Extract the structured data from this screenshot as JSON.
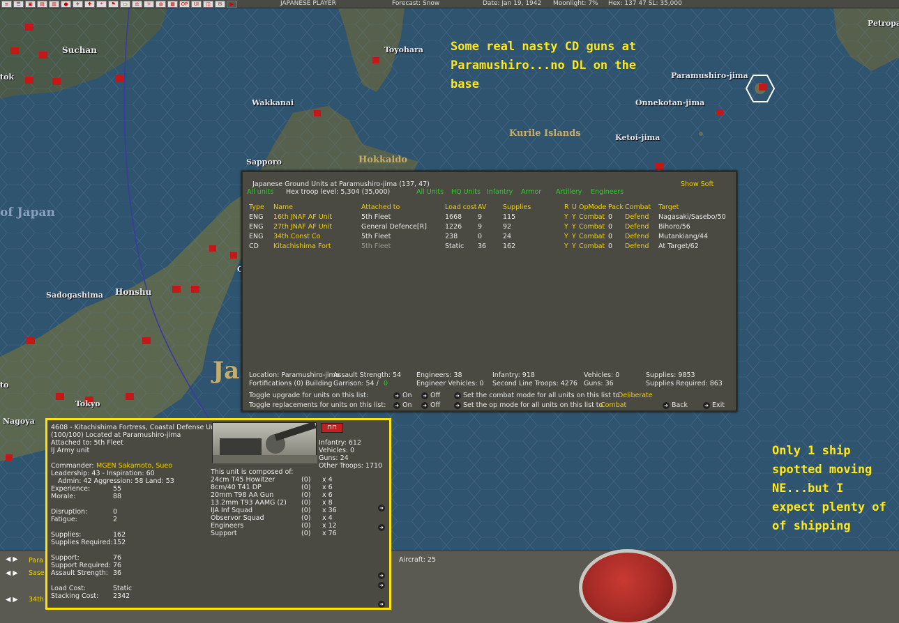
{
  "topbar": {
    "icons": [
      "menu-icon",
      "list-icon",
      "save-icon",
      "report-icon",
      "intel-icon",
      "japan-flag-icon",
      "aircraft-icon",
      "ship-icon",
      "location-icon",
      "flag-icon",
      "bars-icon",
      "balance-icon",
      "sun-icon",
      "globe-icon",
      "doc-icon",
      "op-icon",
      "ui-icon",
      "window-icon",
      "mail-icon",
      "play-icon"
    ],
    "player": "JAPANESE PLAYER",
    "forecast": "Forecast: Snow",
    "date": "Date: Jan 19, 1942",
    "moonlight": "Moonlight: 7%",
    "hex": "Hex: 137 47  SL: 35,000"
  },
  "map": {
    "places": [
      {
        "name": "Suchan"
      },
      {
        "name": "Toyohara"
      },
      {
        "name": "Wakkanai"
      },
      {
        "name": "Sapporo"
      },
      {
        "name": "Paramushiro-jima"
      },
      {
        "name": "Onnekotan-jima"
      },
      {
        "name": "Ketoi-jima"
      },
      {
        "name": "Petropa"
      },
      {
        "name": "tok"
      },
      {
        "name": "Sadogashima"
      },
      {
        "name": "Honshu"
      },
      {
        "name": "Tokyo"
      },
      {
        "name": "Nagoya"
      },
      {
        "name": "to"
      },
      {
        "name": "C"
      }
    ],
    "regions": [
      {
        "name": "Kurile Islands"
      },
      {
        "name": "Hokkaido"
      },
      {
        "name": "of Japan"
      },
      {
        "name": "Ja"
      }
    ],
    "notes": [
      {
        "text": "Some real nasty CD guns at\nParamushiro...no DL on the\nbase"
      },
      {
        "text": "Only 1 ship\nspotted moving\nNE...but I\nexpect plenty of\nof shipping"
      }
    ]
  },
  "ground_units": {
    "title": "Japanese Ground Units at Paramushiro-jima  (137, 47)",
    "show_soft": "Show Soft",
    "all_units": "All units",
    "hex_troop_level": "Hex troop level: 5,304  (35,000)",
    "filters": [
      "All Units",
      "HQ Units",
      "Infantry",
      "Armor",
      "Artillery",
      "Engineers"
    ],
    "columns": [
      "Type",
      "Name",
      "Attached to",
      "Load cost",
      "AV",
      "Supplies",
      "R",
      "U",
      "OpMode",
      "Pack",
      "Combat",
      "Target"
    ],
    "rows": [
      {
        "type": "ENG",
        "name": "16th JNAF AF Unit",
        "attached": "5th Fleet",
        "load": "1668",
        "av": "9",
        "supplies": "115",
        "r": "Y",
        "u": "Y",
        "opmode": "Combat",
        "pack": "0",
        "combat": "Defend",
        "target": "Nagasaki/Sasebo/50"
      },
      {
        "type": "ENG",
        "name": "27th JNAF AF Unit",
        "attached": "General Defence[R]",
        "load": "1226",
        "av": "9",
        "supplies": "92",
        "r": "Y",
        "u": "Y",
        "opmode": "Combat",
        "pack": "0",
        "combat": "Defend",
        "target": "Bihoro/56"
      },
      {
        "type": "ENG",
        "name": "34th Const Co",
        "attached": "5th Fleet",
        "load": "238",
        "av": "0",
        "supplies": "24",
        "r": "Y",
        "u": "Y",
        "opmode": "Combat",
        "pack": "0",
        "combat": "Defend",
        "target": "Mutankiang/44"
      },
      {
        "type": "CD",
        "name": "Kitachishima Fort",
        "attached": "5th Fleet",
        "load": "Static",
        "av": "36",
        "supplies": "162",
        "r": "Y",
        "u": "Y",
        "opmode": "Combat",
        "pack": "0",
        "combat": "Defend",
        "target": "At Target/62"
      }
    ],
    "summary": {
      "location": "Location: Paramushiro-jima",
      "fortifications": "Fortifications (0) Building",
      "assault": "Assault Strength: 54",
      "garrison": "Garrison: 54  /",
      "garrison_req": "0",
      "engineers": "Engineers: 38",
      "eng_vehicles": "Engineer Vehicles: 0",
      "infantry": "Infantry: 918",
      "second_line": "Second Line Troops: 4276",
      "vehicles": "Vehicles: 0",
      "guns": "Guns: 36",
      "supplies": "Supplies: 9853",
      "supplies_req": "Supplies Required: 863"
    },
    "toggle_upgrade": "Toggle upgrade for units on this list:",
    "toggle_replace": "Toggle replacements for units on this list:",
    "on": "On",
    "off": "Off",
    "combat_mode_text": "Set the combat mode for all units on this list to",
    "combat_mode_val": "Deliberate",
    "op_mode_text": "Set the op mode for all units on this list to",
    "op_mode_val": "Combat",
    "back": "Back",
    "exit": "Exit"
  },
  "unit_detail": {
    "title": "4608 - Kitachishima Fortress, Coastal Defense Un",
    "located": "(100/100) Located at  Paramushiro-jima",
    "attached": "Attached to:  5th Fleet",
    "unit_type": "IJ Army unit",
    "commander_label": "Commander: ",
    "commander": "MGEN Sakamoto, Sueo",
    "leadership": "Leadership: 43 - Inspiration: 60",
    "admin": "Admin: 42  Aggression: 58  Land: 53",
    "stats": [
      {
        "label": "Experience:",
        "value": "55"
      },
      {
        "label": "Morale:",
        "value": "88"
      },
      {
        "label": "Disruption:",
        "value": "0"
      },
      {
        "label": "Fatigue:",
        "value": "2"
      },
      {
        "label": "Supplies:",
        "value": "162"
      },
      {
        "label": "Supplies Required:",
        "value": "152"
      },
      {
        "label": "Support:",
        "value": "76"
      },
      {
        "label": "Support Required:",
        "value": "76"
      },
      {
        "label": "Assault Strength:",
        "value": "36"
      },
      {
        "label": "Load Cost:",
        "value": "Static"
      },
      {
        "label": "Stacking Cost:",
        "value": "2342"
      }
    ],
    "troops": {
      "infantry": "Infantry: 612",
      "vehicles": "Vehicles: 0",
      "guns": "Guns: 24",
      "other": "Other Troops: 1710"
    },
    "composed_title": "This unit is composed of:",
    "components": [
      {
        "name": "24cm T45 Howitzer",
        "dis": "(0)",
        "count": "x 4"
      },
      {
        "name": "8cm/40 T41 DP",
        "dis": "(0)",
        "count": "x 6"
      },
      {
        "name": "20mm T98 AA Gun",
        "dis": "(0)",
        "count": "x 6"
      },
      {
        "name": "13.2mm T93 AAMG (2)",
        "dis": "(0)",
        "count": "x 8"
      },
      {
        "name": "IJA Inf Squad",
        "dis": "(0)",
        "count": "x 36"
      },
      {
        "name": "Observor Squad",
        "dis": "(0)",
        "count": "x 4"
      },
      {
        "name": "Engineers",
        "dis": "(0)",
        "count": "x 12"
      },
      {
        "name": "Support",
        "dis": "(0)",
        "count": "x 76"
      }
    ]
  },
  "bottom": {
    "aircraft": "Aircraft: 25",
    "side_items": [
      "Para",
      "Sase",
      "34th"
    ]
  }
}
